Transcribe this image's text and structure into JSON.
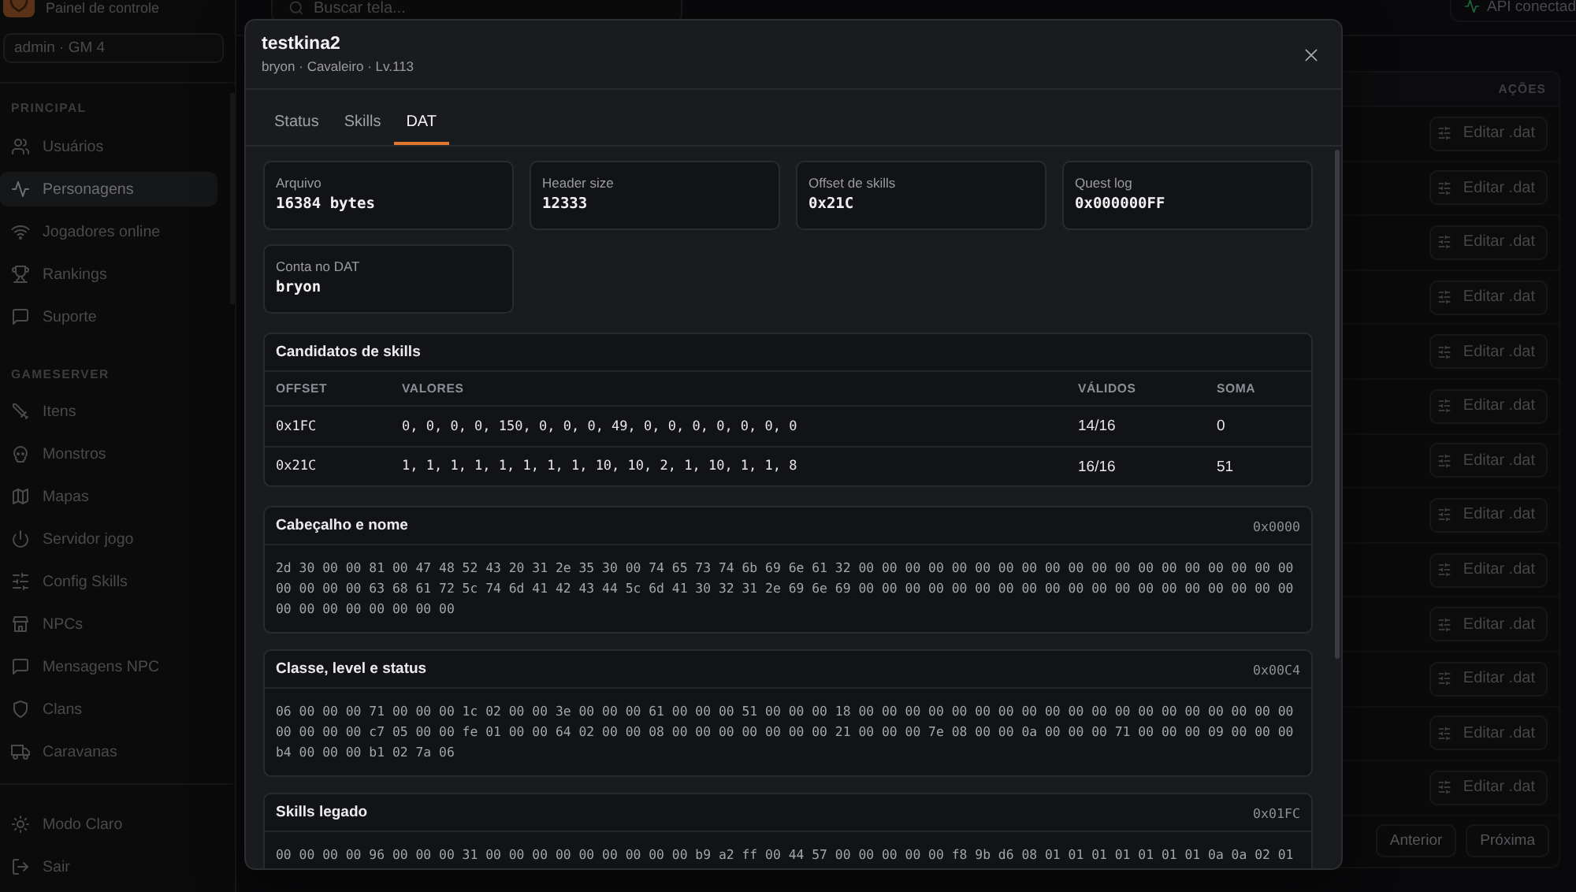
{
  "sidebar": {
    "brand_subtitle": "Painel de controle",
    "user_badge": "admin · GM 4",
    "sections": [
      {
        "title": "PRINCIPAL",
        "items": [
          {
            "label": "Usuários",
            "selected": false
          },
          {
            "label": "Personagens",
            "selected": true
          },
          {
            "label": "Jogadores online",
            "selected": false
          },
          {
            "label": "Rankings",
            "selected": false
          },
          {
            "label": "Suporte",
            "selected": false
          }
        ]
      },
      {
        "title": "GAMESERVER",
        "items": [
          {
            "label": "Itens",
            "selected": false
          },
          {
            "label": "Monstros",
            "selected": false
          },
          {
            "label": "Mapas",
            "selected": false
          },
          {
            "label": "Servidor jogo",
            "selected": false
          },
          {
            "label": "Config Skills",
            "selected": false
          },
          {
            "label": "NPCs",
            "selected": false
          },
          {
            "label": "Mensagens NPC",
            "selected": false
          },
          {
            "label": "Clans",
            "selected": false
          },
          {
            "label": "Caravanas",
            "selected": false
          }
        ]
      }
    ],
    "theme_toggle": "Modo Claro",
    "logout": "Sair"
  },
  "topbar": {
    "search": {
      "placeholder": "Buscar tela..."
    },
    "api_status": "API conectad"
  },
  "table": {
    "columns": [
      {
        "label": "AÇÕES"
      }
    ],
    "rows": [
      {
        "action": "Editar .dat"
      },
      {
        "action": "Editar .dat"
      },
      {
        "action": "Editar .dat"
      },
      {
        "action": "Editar .dat"
      },
      {
        "action": "Editar .dat"
      },
      {
        "action": "Editar .dat"
      },
      {
        "action": "Editar .dat"
      },
      {
        "action": "Editar .dat"
      },
      {
        "action": "Editar .dat"
      },
      {
        "action": "Editar .dat"
      },
      {
        "action": "Editar .dat"
      },
      {
        "action": "Editar .dat"
      },
      {
        "action": "Editar .dat"
      }
    ]
  },
  "pagination": {
    "previous": "Anterior",
    "next": "Próxima"
  },
  "dialog": {
    "title": "testkina2",
    "subtitle": "bryon · Cavaleiro · Lv.113",
    "tabs": [
      {
        "label": "Status",
        "selected": false
      },
      {
        "label": "Skills",
        "selected": false
      },
      {
        "label": "DAT",
        "selected": true
      }
    ],
    "stats": [
      {
        "label": "Arquivo",
        "value": "16384 bytes"
      },
      {
        "label": "Header size",
        "value": "12333"
      },
      {
        "label": "Offset de skills",
        "value": "0x21C"
      },
      {
        "label": "Quest log",
        "value": "0x000000FF"
      },
      {
        "label": "Conta no DAT",
        "value": "bryon"
      }
    ],
    "skill_candidates": {
      "title": "Candidatos de skills",
      "columns": [
        "OFFSET",
        "VALORES",
        "VÁLIDOS",
        "SOMA"
      ],
      "rows": [
        {
          "offset": "0x1FC",
          "values": "0, 0, 0, 0, 150, 0, 0, 0, 49, 0, 0, 0, 0, 0, 0, 0",
          "valid": "14/16",
          "sum": "0"
        },
        {
          "offset": "0x21C",
          "values": "1, 1, 1, 1, 1, 1, 1, 1, 10, 10, 2, 1, 10, 1, 1, 8",
          "valid": "16/16",
          "sum": "51"
        }
      ]
    },
    "hex_sections": [
      {
        "title": "Cabeçalho e nome",
        "offset": "0x0000",
        "lines": [
          "2d 30 00 00 81 00 47 48 52 43 20 31 2e 35 30 00 74 65 73 74 6b 69 6e 61 32 00 00 00 00 00 00 00 00 00 00 00 00 00 00 00 00 00 00 00",
          "00 00 00 00 63 68 61 72 5c 74 6d 41 42 43 44 5c 6d 41 30 32 31 2e 69 6e 69 00 00 00 00 00 00 00 00 00 00 00 00 00 00 00 00 00 00 00",
          "00 00 00 00 00 00 00 00"
        ]
      },
      {
        "title": "Classe, level e status",
        "offset": "0x00C4",
        "lines": [
          "06 00 00 00 71 00 00 00 1c 02 00 00 3e 00 00 00 61 00 00 00 51 00 00 00 18 00 00 00 00 00 00 00 00 00 00 00 00 00 00 00 00 00 00 00",
          "00 00 00 00 c7 05 00 00 fe 01 00 00 64 02 00 00 08 00 00 00 00 00 00 00 21 00 00 00 7e 08 00 00 0a 00 00 00 71 00 00 00 09 00 00 00",
          "b4 00 00 00 b1 02 7a 06"
        ]
      },
      {
        "title": "Skills legado",
        "offset": "0x01FC",
        "lines": [
          "00 00 00 00 96 00 00 00 31 00 00 00 00 00 00 00 00 00 b9 a2 ff 00 44 57 00 00 00 00 00 f8 9b d6 08 01 01 01 01 01 01 01 0a 0a 02 01"
        ]
      }
    ]
  }
}
